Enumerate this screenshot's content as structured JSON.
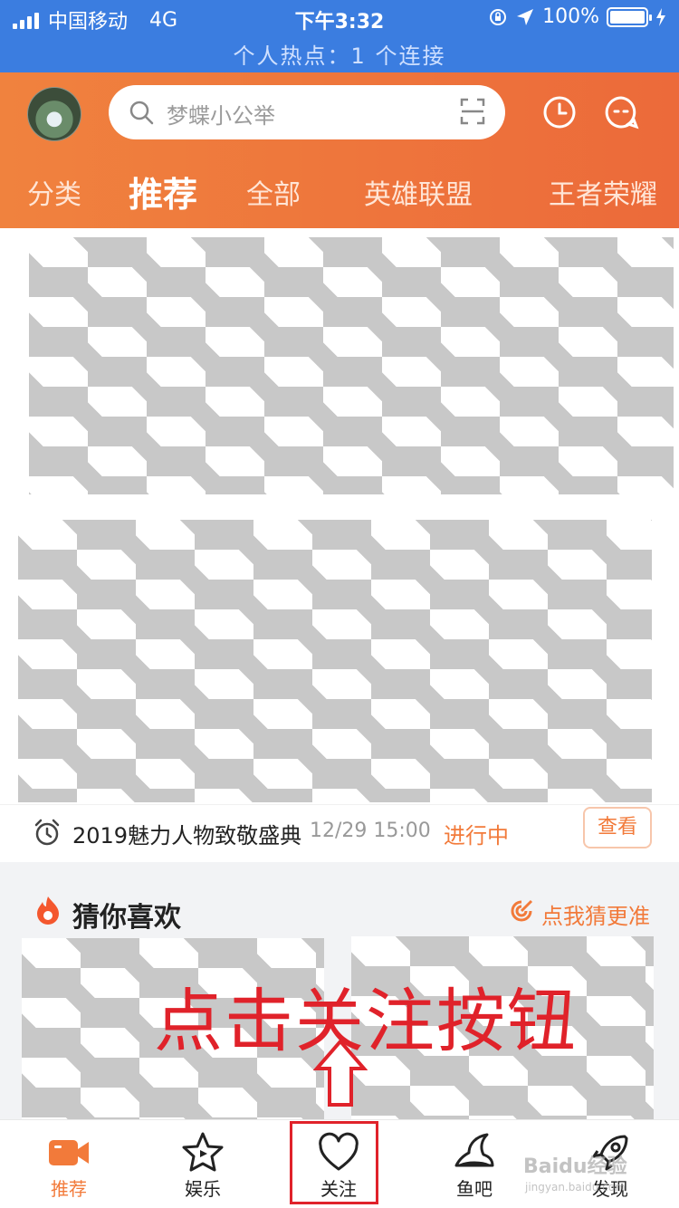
{
  "status_bar": {
    "carrier": "中国移动",
    "network": "4G",
    "time": "下午3:32",
    "battery": "100%",
    "hotspot": "个人热点：1 个连接"
  },
  "header": {
    "search_placeholder": "梦蝶小公举",
    "tabs": [
      {
        "label": "分类",
        "active": false
      },
      {
        "label": "推荐",
        "active": true
      },
      {
        "label": "全部",
        "active": false
      },
      {
        "label": "英雄联盟",
        "active": false
      },
      {
        "label": "王者荣耀",
        "active": false
      }
    ]
  },
  "event": {
    "title": "2019魅力人物致敬盛典",
    "time": "12/29 15:00",
    "status": "进行中",
    "button": "查看"
  },
  "guess": {
    "title": "猜你喜欢",
    "more": "点我猜更准"
  },
  "annotation": {
    "text": "点击关注按钮"
  },
  "bottom_nav": {
    "items": [
      {
        "label": "推荐",
        "icon": "video-camera-icon",
        "active": true
      },
      {
        "label": "娱乐",
        "icon": "star-icon",
        "active": false
      },
      {
        "label": "关注",
        "icon": "heart-icon",
        "active": false
      },
      {
        "label": "鱼吧",
        "icon": "fish-hat-icon",
        "active": false
      },
      {
        "label": "发现",
        "icon": "rocket-icon",
        "active": false
      }
    ]
  },
  "watermark": {
    "brand": "Baidu经验",
    "url": "jingyan.baidu.com"
  },
  "colors": {
    "accent": "#f27a3a",
    "status_bar": "#3b7de0",
    "annotation": "#e0222a"
  }
}
